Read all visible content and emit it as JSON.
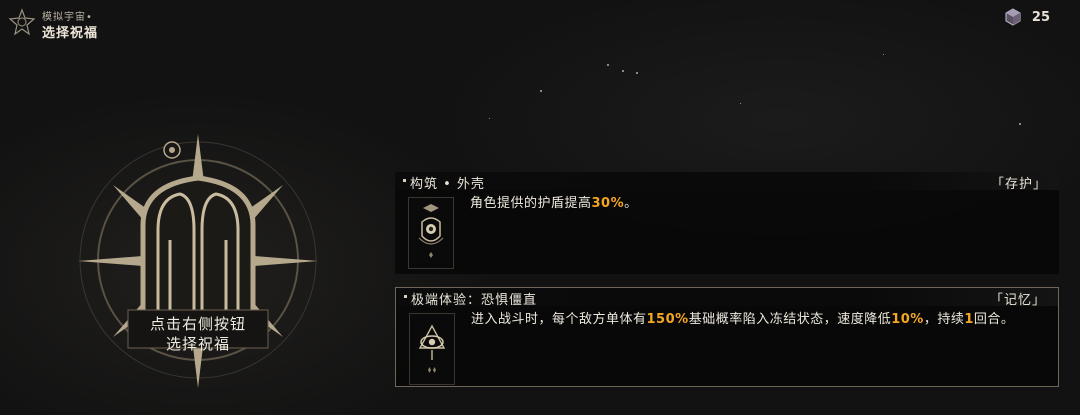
{
  "header": {
    "subtitle": "模拟宇宙•",
    "title": "选择祝福",
    "emblem_icon": "universe-emblem-icon"
  },
  "currency": {
    "icon": "cosmic-fragment-icon",
    "amount": "25"
  },
  "center_emblem": {
    "icon": "preservation-path-emblem-icon",
    "instruction_line1": "点击右侧按钮",
    "instruction_line2": "选择祝福"
  },
  "blessings": [
    {
      "name": "构筑 • 外壳",
      "path_tag": "「存护」",
      "icon": "shell-blessing-icon",
      "desc_parts": [
        "角色提供的护盾提高",
        "30%",
        "。"
      ],
      "selected": false
    },
    {
      "name": "极端体验：恐惧僵直",
      "path_tag": "「记忆」",
      "icon": "remembrance-eye-icon",
      "desc_parts": [
        "进入战斗时，每个敌方单体有",
        "150%",
        "基础概率陷入冻结状态，速度降低",
        "10%",
        "，持续",
        "1",
        "回合。"
      ],
      "selected": true
    }
  ],
  "colors": {
    "highlight": "#f5a623",
    "background": "#121212",
    "selected_border": "#6e6656",
    "emblem_gold": "#b5a88c"
  }
}
